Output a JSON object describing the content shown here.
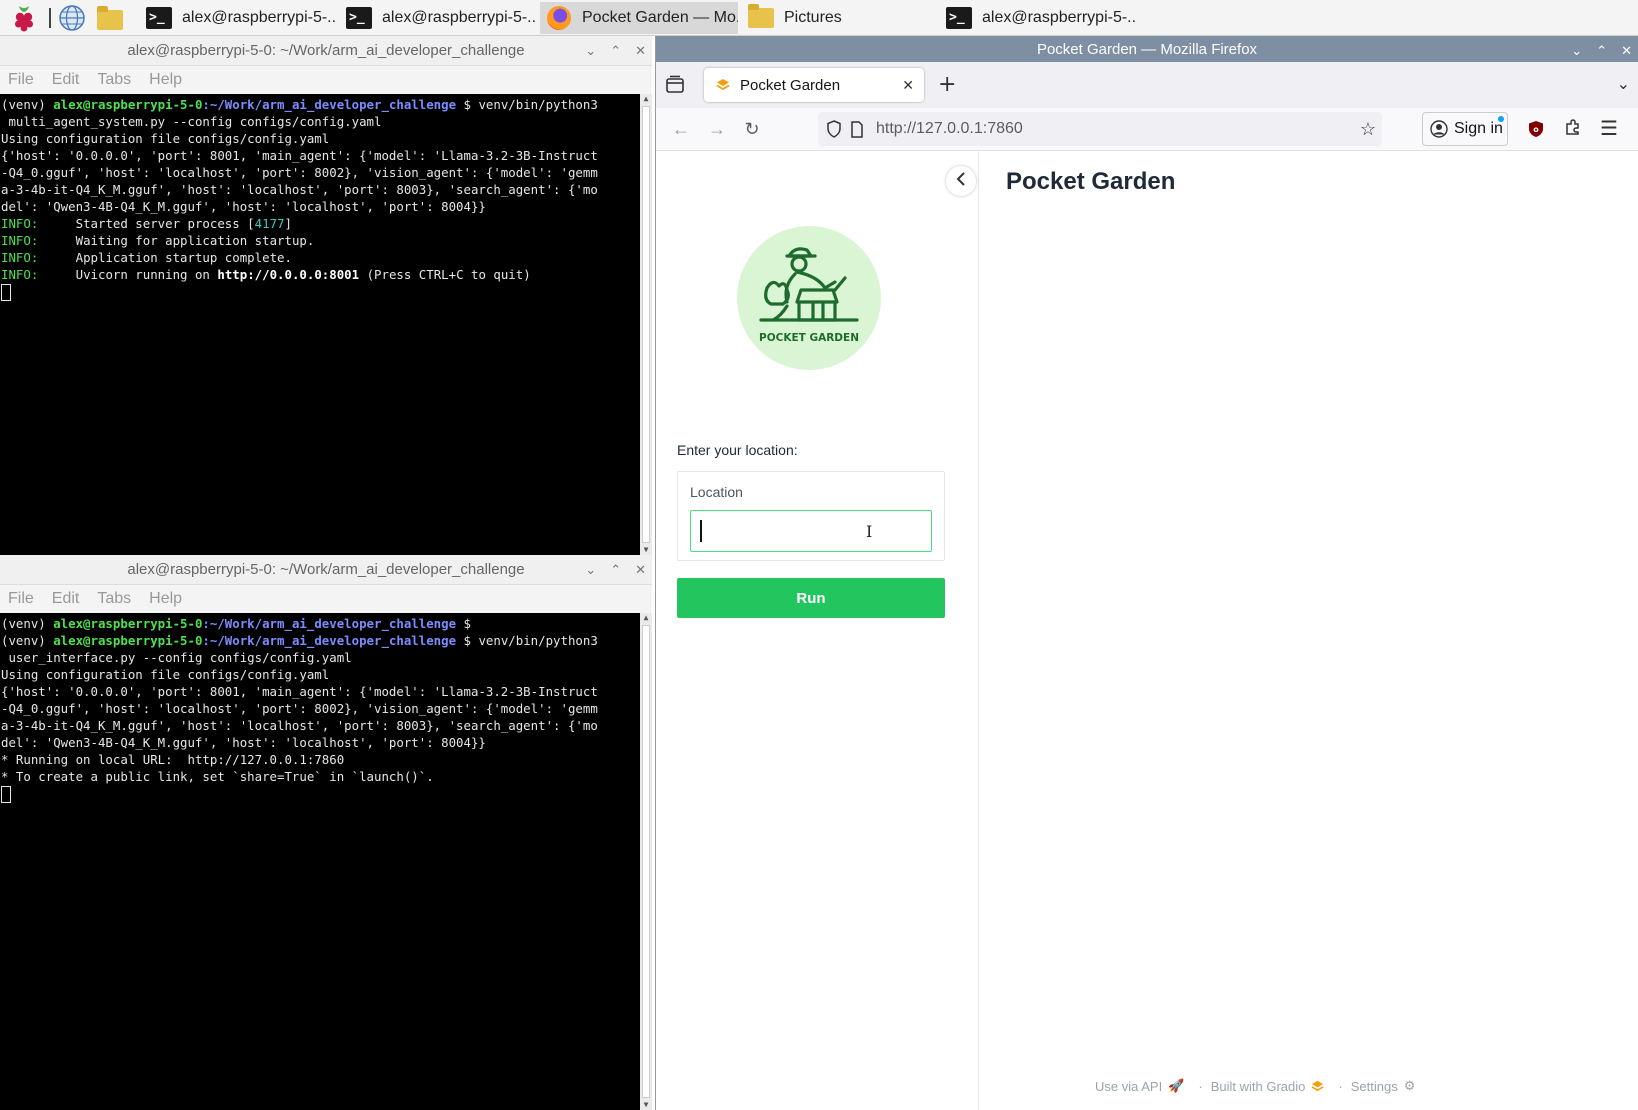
{
  "taskbar": {
    "tasks": [
      {
        "label": "alex@raspberrypi-5-..."
      },
      {
        "label": "alex@raspberrypi-5-..."
      },
      {
        "label": "Pocket Garden — Mo..."
      },
      {
        "label": "Pictures"
      },
      {
        "label": "alex@raspberrypi-5-..."
      }
    ]
  },
  "terminal1": {
    "title": "alex@raspberrypi-5-0: ~/Work/arm_ai_developer_challenge",
    "menu": [
      "File",
      "Edit",
      "Tabs",
      "Help"
    ],
    "prompt_env": "(venv) ",
    "prompt_user": "alex@raspberrypi-5-0",
    "prompt_path": ":~/Work/arm_ai_developer_challenge",
    "prompt_sym": " $ ",
    "cmd1": "venv/bin/python3",
    "cmd2": " multi_agent_system.py --config configs/config.yaml",
    "out1": "Using configuration file configs/config.yaml",
    "cfg1": "{'host': '0.0.0.0', 'port': 8001, 'main_agent': {'model': 'Llama-3.2-3B-Instruct",
    "cfg2": "-Q4_0.gguf', 'host': 'localhost', 'port': 8002}, 'vision_agent': {'model': 'gemm",
    "cfg3": "a-3-4b-it-Q4_K_M.gguf', 'host': 'localhost', 'port': 8003}, 'search_agent': {'mo",
    "cfg4": "del': 'Qwen3-4B-Q4_K_M.gguf', 'host': 'localhost', 'port': 8004}}",
    "info_tag": "INFO:",
    "info1_a": "     Started server process [",
    "info1_pid": "4177",
    "info1_b": "]",
    "info2": "     Waiting for application startup.",
    "info3": "     Application startup complete.",
    "info4_a": "     Uvicorn running on ",
    "info4_url": "http://0.0.0.0:8001",
    "info4_b": " (Press CTRL+C to quit)"
  },
  "terminal2": {
    "title": "alex@raspberrypi-5-0: ~/Work/arm_ai_developer_challenge",
    "menu": [
      "File",
      "Edit",
      "Tabs",
      "Help"
    ],
    "cmd1": "venv/bin/python3",
    "cmd2": " user_interface.py --config configs/config.yaml",
    "out1": "Using configuration file configs/config.yaml",
    "run1": "* Running on local URL:  http://127.0.0.1:7860",
    "run2": "* To create a public link, set `share=True` in `launch()`."
  },
  "firefox": {
    "window_title": "Pocket Garden — Mozilla Firefox",
    "tab_title": "Pocket Garden",
    "url": "http://127.0.0.1:7860",
    "sign_in": "Sign in"
  },
  "app": {
    "title": "Pocket Garden",
    "logo_text": "POCKET GARDEN",
    "location_prompt": "Enter your location:",
    "location_label": "Location",
    "location_value": "",
    "run_label": "Run",
    "accent": "#22c55e",
    "footer": {
      "api": "Use via API",
      "built": "Built with Gradio",
      "settings": "Settings"
    }
  }
}
